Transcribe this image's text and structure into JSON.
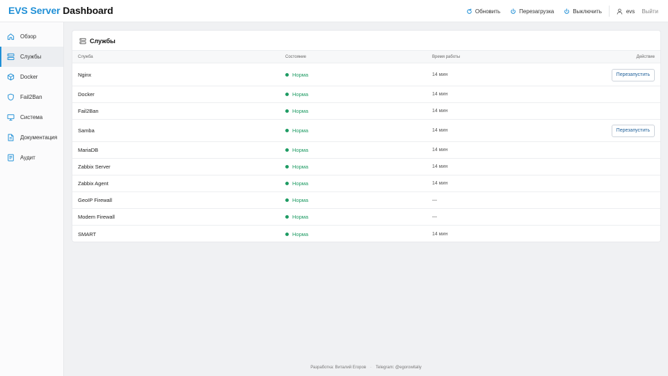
{
  "brand": {
    "accent": "EVS Server",
    "rest": "Dashboard"
  },
  "header": {
    "refresh": "Обновить",
    "reboot": "Перезагрузка",
    "shutdown": "Выключить",
    "user": "evs",
    "logout": "Выйти"
  },
  "sidebar": {
    "items": [
      {
        "label": "Обзор",
        "icon": "home-icon",
        "active": false
      },
      {
        "label": "Службы",
        "icon": "services-icon",
        "active": true
      },
      {
        "label": "Docker",
        "icon": "cube-icon",
        "active": false
      },
      {
        "label": "Fail2Ban",
        "icon": "shield-icon",
        "active": false
      },
      {
        "label": "Система",
        "icon": "monitor-icon",
        "active": false
      },
      {
        "label": "Документация",
        "icon": "document-icon",
        "active": false
      },
      {
        "label": "Аудит",
        "icon": "clipboard-icon",
        "active": false
      }
    ]
  },
  "services": {
    "title": "Службы",
    "columns": {
      "name": "Служба",
      "state": "Состояние",
      "uptime": "Время работы",
      "action": "Действие"
    },
    "rows": [
      {
        "name": "Nginx",
        "state": "Норма",
        "uptime": "14 мин",
        "action": "Перезапустить"
      },
      {
        "name": "Docker",
        "state": "Норма",
        "uptime": "14 мин",
        "action": ""
      },
      {
        "name": "Fail2Ban",
        "state": "Норма",
        "uptime": "14 мин",
        "action": ""
      },
      {
        "name": "Samba",
        "state": "Норма",
        "uptime": "14 мин",
        "action": "Перезапустить"
      },
      {
        "name": "MariaDB",
        "state": "Норма",
        "uptime": "14 мин",
        "action": ""
      },
      {
        "name": "Zabbix Server",
        "state": "Норма",
        "uptime": "14 мин",
        "action": ""
      },
      {
        "name": "Zabbix Agent",
        "state": "Норма",
        "uptime": "14 мин",
        "action": ""
      },
      {
        "name": "GeoIP Firewall",
        "state": "Норма",
        "uptime": "—",
        "action": ""
      },
      {
        "name": "Modem Firewall",
        "state": "Норма",
        "uptime": "—",
        "action": ""
      },
      {
        "name": "SMART",
        "state": "Норма",
        "uptime": "14 мин",
        "action": ""
      }
    ]
  },
  "footer": {
    "developer": "Разработка: Виталий Егоров",
    "telegram": "Telegram: @egorowitaliy"
  },
  "colors": {
    "accent": "#1f8fd6",
    "ok": "#1e9b63",
    "link": "#1e5f99"
  }
}
